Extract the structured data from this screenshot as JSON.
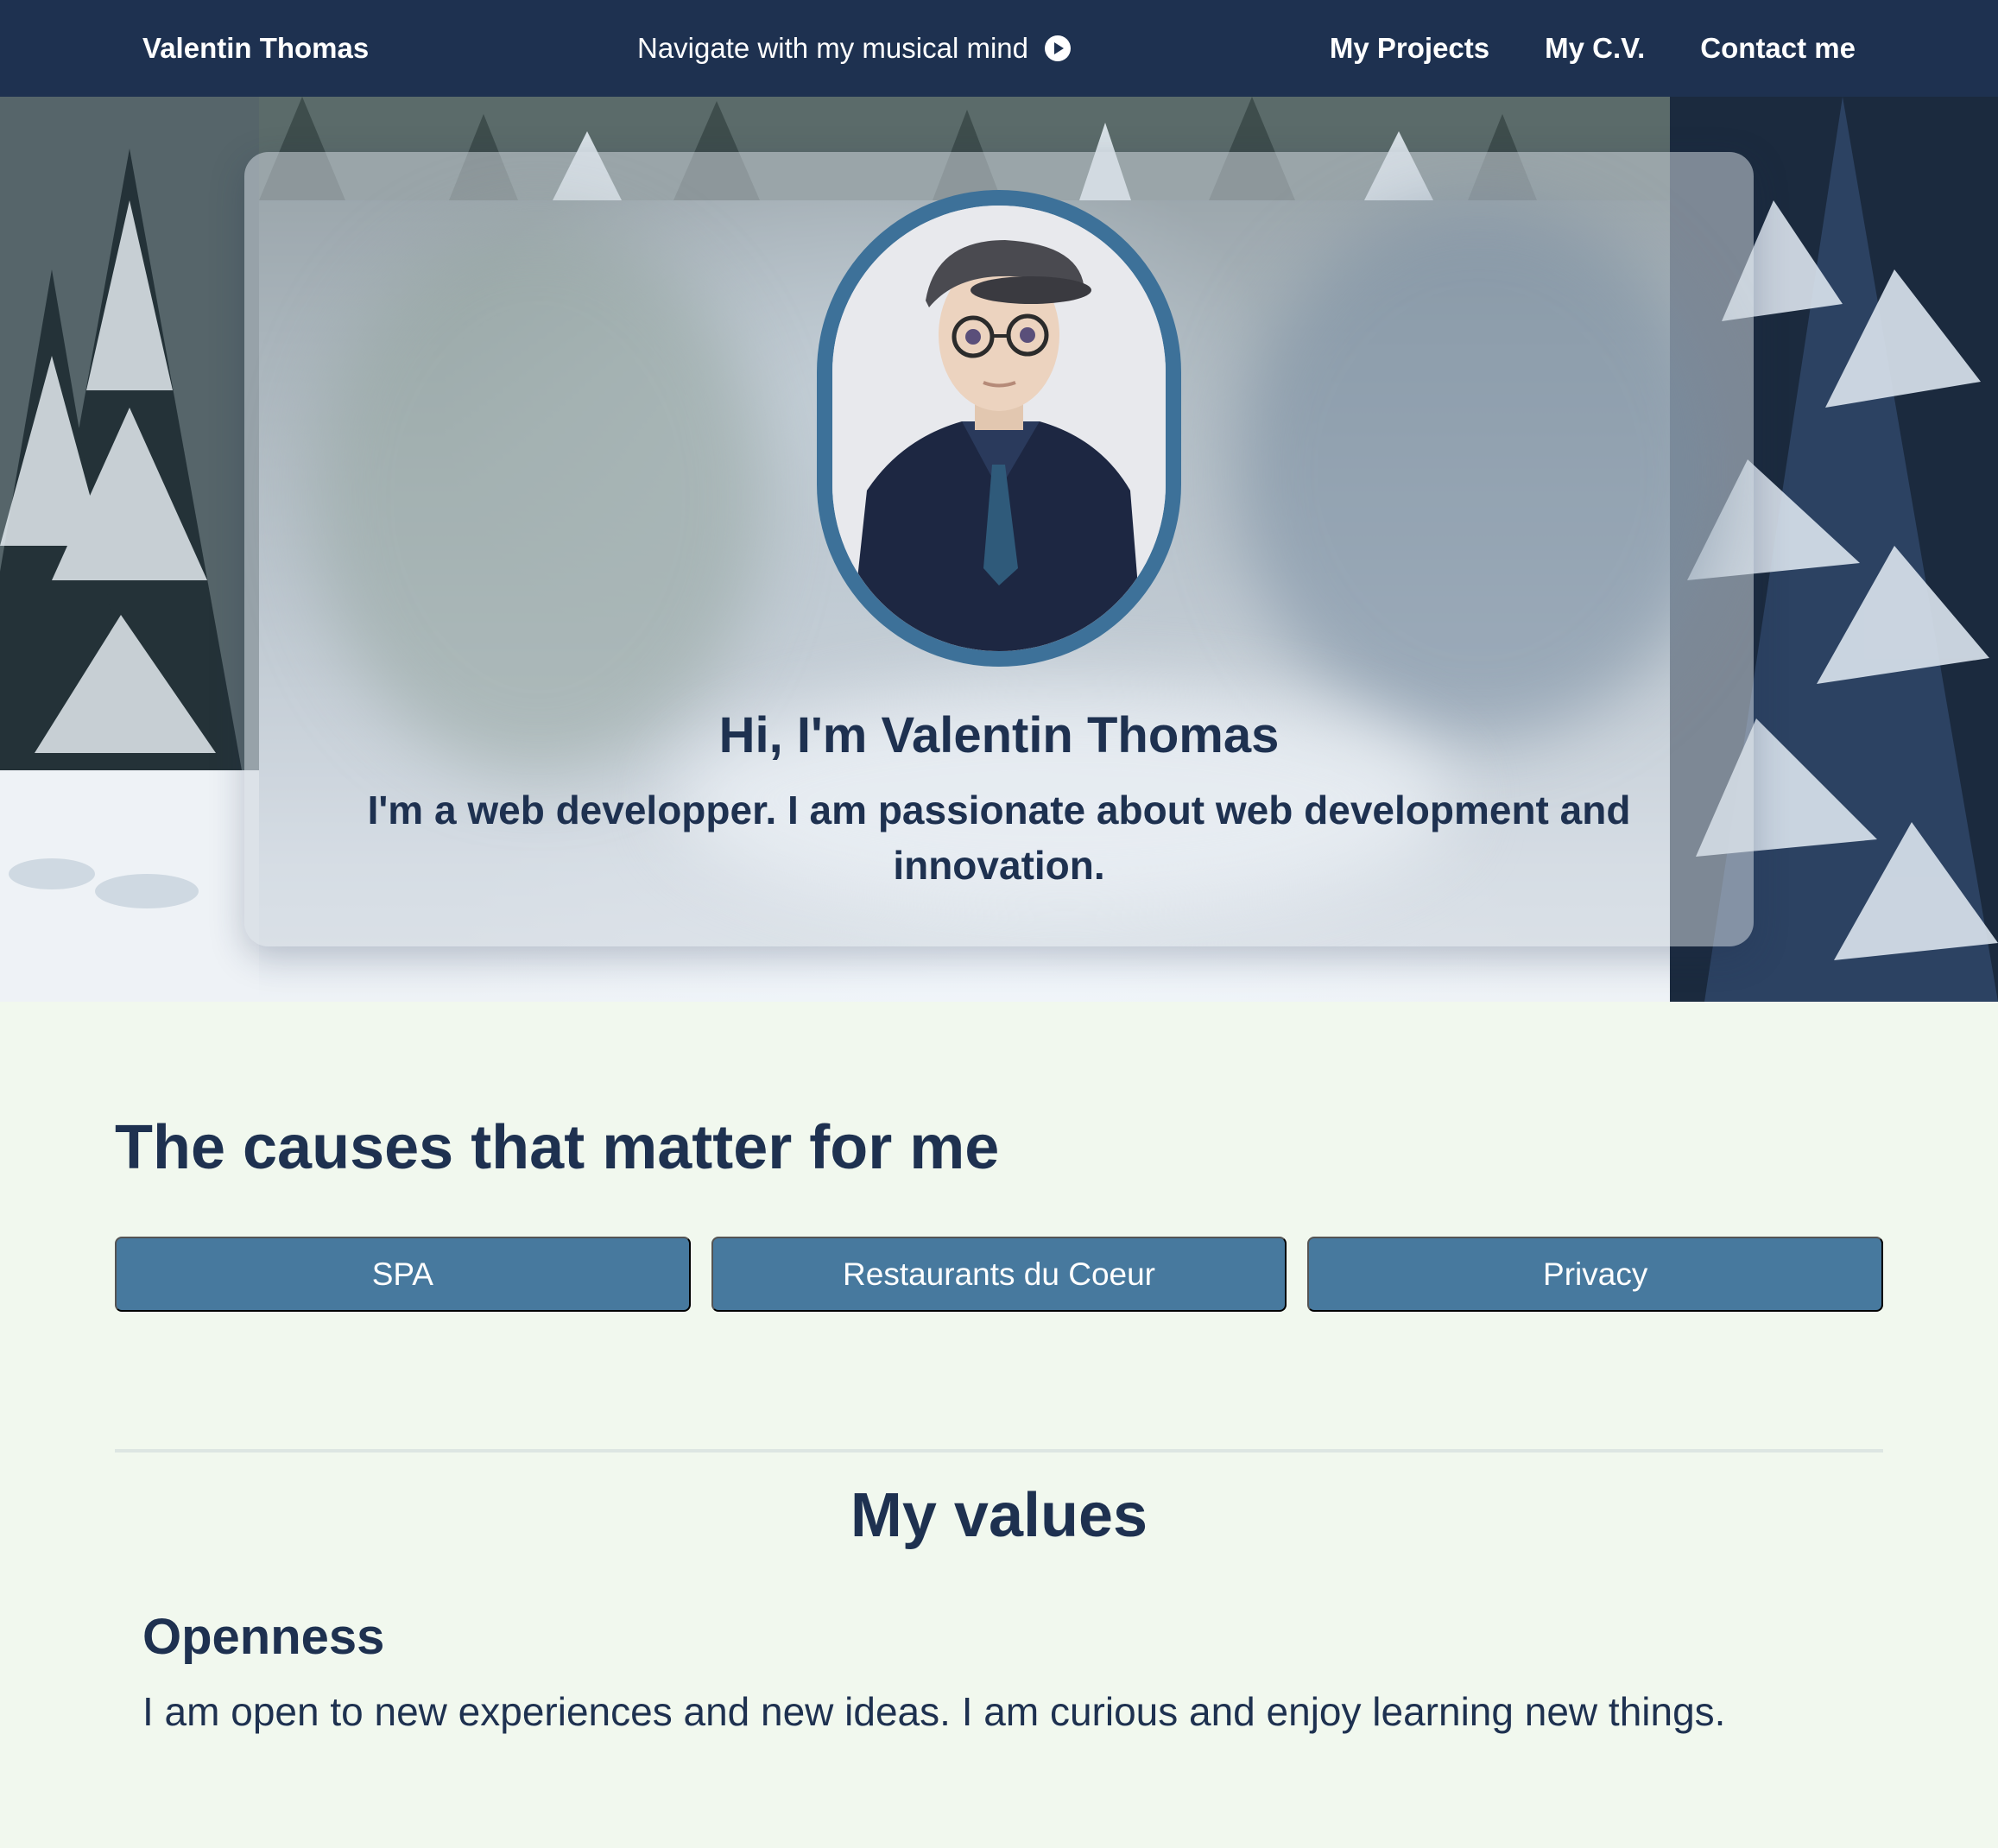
{
  "navbar": {
    "brand": "Valentin Thomas",
    "music_label": "Navigate with my musical mind",
    "music_icon": "play-circle-icon",
    "links": [
      "My Projects",
      "My C.V.",
      "Contact me"
    ]
  },
  "hero": {
    "title": "Hi, I'm Valentin Thomas",
    "subtitle": "I'm a web developper. I am passionate about web development and innovation."
  },
  "causes": {
    "title": "The causes that matter for me",
    "items": [
      "SPA",
      "Restaurants du Coeur",
      "Privacy"
    ]
  },
  "values": {
    "title": "My values",
    "items": [
      {
        "name": "Openness",
        "description": "I am open to new experiences and new ideas. I am curious and enjoy learning new things."
      }
    ]
  },
  "colors": {
    "navbar_bg": "#1e3150",
    "text_dark": "#1e3150",
    "button_bg": "#47799e",
    "page_bg": "#f1f8ee",
    "avatar_border": "#3d7199"
  }
}
